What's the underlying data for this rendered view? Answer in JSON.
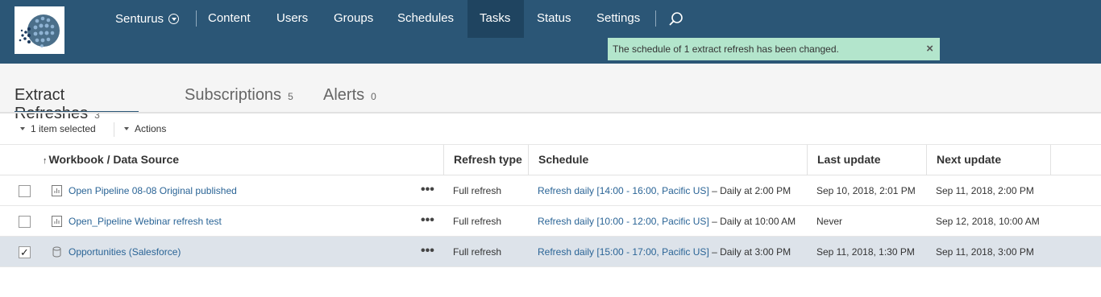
{
  "header": {
    "site_name": "Senturus",
    "nav": [
      "Content",
      "Users",
      "Groups",
      "Schedules",
      "Tasks",
      "Status",
      "Settings"
    ],
    "active_nav": "Tasks"
  },
  "toast": {
    "message": "The schedule of 1 extract refresh has been changed.",
    "close": "×"
  },
  "tabs": [
    {
      "label": "Extract Refreshes",
      "count": "3"
    },
    {
      "label": "Subscriptions",
      "count": "5"
    },
    {
      "label": "Alerts",
      "count": "0"
    }
  ],
  "toolbar": {
    "selection": "1 item selected",
    "actions": "Actions"
  },
  "table": {
    "columns": [
      "Workbook / Data Source",
      "Refresh type",
      "Schedule",
      "Last update",
      "Next update"
    ],
    "sort_arrow": "↑",
    "rows": [
      {
        "name": "Open Pipeline 08-08 Original published",
        "refresh_type": "Full refresh",
        "schedule_link": "Refresh daily [14:00 - 16:00, Pacific US]",
        "schedule_detail": " – Daily at 2:00 PM",
        "last_update": "Sep 10, 2018, 2:01 PM",
        "next_update": "Sep 11, 2018, 2:00 PM",
        "checked": false,
        "icon": "workbook-icon"
      },
      {
        "name": "Open_Pipeline Webinar refresh test",
        "refresh_type": "Full refresh",
        "schedule_link": "Refresh daily [10:00 - 12:00, Pacific US]",
        "schedule_detail": " – Daily at 10:00 AM",
        "last_update": "Never",
        "next_update": "Sep 12, 2018, 10:00 AM",
        "checked": false,
        "icon": "workbook-icon"
      },
      {
        "name": "Opportunities (Salesforce)",
        "refresh_type": "Full refresh",
        "schedule_link": "Refresh daily [15:00 - 17:00, Pacific US]",
        "schedule_detail": " – Daily at 3:00 PM",
        "last_update": "Sep 11, 2018, 1:30 PM",
        "next_update": "Sep 11, 2018, 3:00 PM",
        "checked": true,
        "icon": "datasource-icon"
      }
    ],
    "more": "•••",
    "check_mark": "✓"
  },
  "colors": {
    "header_bg": "#2b5676",
    "active_tab_bg": "#1f4460",
    "toast_bg": "#b3e5cc",
    "link": "#2a6496",
    "selected_row_bg": "#dde3ea"
  }
}
